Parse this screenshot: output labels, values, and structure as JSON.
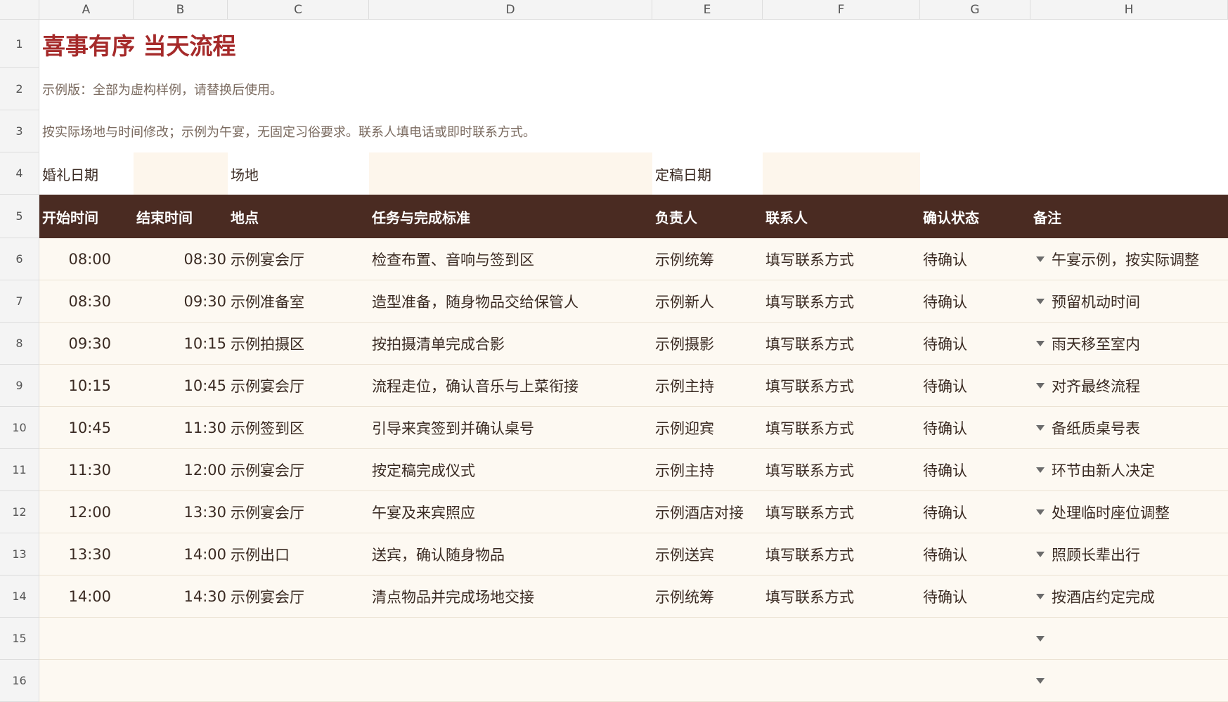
{
  "columns": [
    "A",
    "B",
    "C",
    "D",
    "E",
    "F",
    "G",
    "H"
  ],
  "row_numbers": [
    "1",
    "2",
    "3",
    "4",
    "5",
    "6",
    "7",
    "8",
    "9",
    "10",
    "11",
    "12",
    "13",
    "14",
    "15",
    "16"
  ],
  "title": "喜事有序  当天流程",
  "note1": "示例版：全部为虚构样例，请替换后使用。",
  "note2": "按实际场地与时间修改；示例为午宴，无固定习俗要求。联系人填电话或即时联系方式。",
  "meta": {
    "wedding_date_label": "婚礼日期",
    "wedding_date_value": "",
    "venue_label": "场地",
    "venue_value": "",
    "final_date_label": "定稿日期",
    "final_date_value": ""
  },
  "headers": [
    "开始时间",
    "结束时间",
    "地点",
    "任务与完成标准",
    "负责人",
    "联系人",
    "确认状态",
    "备注"
  ],
  "rows": [
    {
      "start": "08:00",
      "end": "08:30",
      "place": "示例宴会厅",
      "task": "检查布置、音响与签到区",
      "owner": "示例统筹",
      "contact": "填写联系方式",
      "status": "待确认",
      "remark": "午宴示例，按实际调整"
    },
    {
      "start": "08:30",
      "end": "09:30",
      "place": "示例准备室",
      "task": "造型准备，随身物品交给保管人",
      "owner": "示例新人",
      "contact": "填写联系方式",
      "status": "待确认",
      "remark": "预留机动时间"
    },
    {
      "start": "09:30",
      "end": "10:15",
      "place": "示例拍摄区",
      "task": "按拍摄清单完成合影",
      "owner": "示例摄影",
      "contact": "填写联系方式",
      "status": "待确认",
      "remark": "雨天移至室内"
    },
    {
      "start": "10:15",
      "end": "10:45",
      "place": "示例宴会厅",
      "task": "流程走位，确认音乐与上菜衔接",
      "owner": "示例主持",
      "contact": "填写联系方式",
      "status": "待确认",
      "remark": "对齐最终流程"
    },
    {
      "start": "10:45",
      "end": "11:30",
      "place": "示例签到区",
      "task": "引导来宾签到并确认桌号",
      "owner": "示例迎宾",
      "contact": "填写联系方式",
      "status": "待确认",
      "remark": "备纸质桌号表"
    },
    {
      "start": "11:30",
      "end": "12:00",
      "place": "示例宴会厅",
      "task": "按定稿完成仪式",
      "owner": "示例主持",
      "contact": "填写联系方式",
      "status": "待确认",
      "remark": "环节由新人决定"
    },
    {
      "start": "12:00",
      "end": "13:30",
      "place": "示例宴会厅",
      "task": "午宴及来宾照应",
      "owner": "示例酒店对接",
      "contact": "填写联系方式",
      "status": "待确认",
      "remark": "处理临时座位调整"
    },
    {
      "start": "13:30",
      "end": "14:00",
      "place": "示例出口",
      "task": "送宾，确认随身物品",
      "owner": "示例送宾",
      "contact": "填写联系方式",
      "status": "待确认",
      "remark": "照顾长辈出行"
    },
    {
      "start": "14:00",
      "end": "14:30",
      "place": "示例宴会厅",
      "task": "清点物品并完成场地交接",
      "owner": "示例统筹",
      "contact": "填写联系方式",
      "status": "待确认",
      "remark": "按酒店约定完成"
    },
    {
      "start": "",
      "end": "",
      "place": "",
      "task": "",
      "owner": "",
      "contact": "",
      "status": "",
      "remark": ""
    },
    {
      "start": "",
      "end": "",
      "place": "",
      "task": "",
      "owner": "",
      "contact": "",
      "status": "",
      "remark": ""
    }
  ],
  "icons": {
    "dropdown": "chevron-down-icon"
  },
  "colors": {
    "header_bg": "#4a2b22",
    "title": "#a52a2a",
    "row_bg": "#fdf9f2",
    "input_bg": "#fdf6ec"
  }
}
